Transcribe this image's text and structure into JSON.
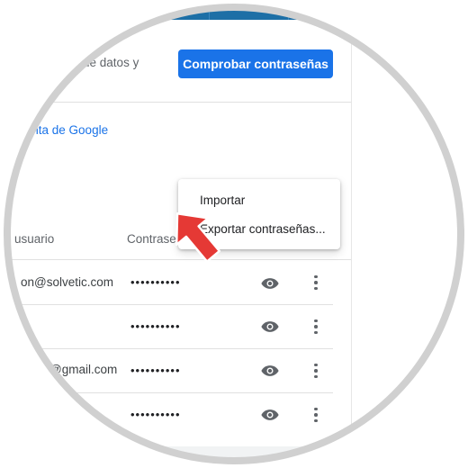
{
  "header": {
    "check_text": "ıdad de datos y",
    "check_button_label": "Comprobar contraseñas"
  },
  "google_link": "ı cuenta de Google",
  "table": {
    "columns": [
      "usuario",
      "Contraseñ"
    ],
    "rows": [
      {
        "user": "on@solvetic.com",
        "password": "••••••••••"
      },
      {
        "user": "",
        "password": "••••••••••"
      },
      {
        "user": "@gmail.com",
        "password": "••••••••••"
      },
      {
        "user": "",
        "password": "••••••••••"
      }
    ]
  },
  "menu": {
    "items": [
      "Importar",
      "Exportar contraseñas..."
    ]
  },
  "colors": {
    "accent": "#1a73e8",
    "pointer_arrow": "#e53935",
    "top_band": "#1d6fa6"
  },
  "icons": {
    "reveal": "eye-icon",
    "more": "more-vert-icon",
    "pointer": "red-arrow-pointer"
  }
}
